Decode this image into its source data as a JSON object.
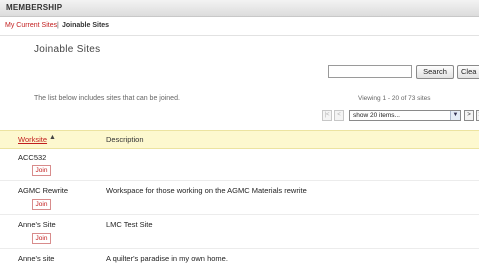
{
  "header": {
    "title": "MEMBERSHIP"
  },
  "nav": {
    "current_sites": "My Current Sites",
    "separator": "|",
    "joinable_sites": "Joinable Sites"
  },
  "page_title": "Joinable Sites",
  "search": {
    "value": "",
    "search_label": "Search",
    "clear_label": "Clea"
  },
  "info_text": "The list below includes sites that can be joined.",
  "pager": {
    "viewing": "Viewing 1 - 20 of 73 sites",
    "select_value": "show 20 items...",
    "first": "|<",
    "prev": "<",
    "next": ">",
    "last": ">|"
  },
  "table": {
    "headers": {
      "worksite": "Worksite",
      "description": "Description"
    },
    "sort_icon": "sort-ascending-icon",
    "rows": [
      {
        "name": "ACC532",
        "description": "",
        "join": "Join"
      },
      {
        "name": "AGMC Rewrite",
        "description": "Workspace for those working on the AGMC Materials rewrite",
        "join": "Join"
      },
      {
        "name": "Anne's Site",
        "description": "LMC Test Site",
        "join": "Join"
      },
      {
        "name": "Anne's site",
        "description": "A quilter's paradise in my own home.",
        "join": ""
      }
    ]
  },
  "colors": {
    "accent_red": "#c21e1e",
    "header_highlight": "#fdf8cf"
  }
}
